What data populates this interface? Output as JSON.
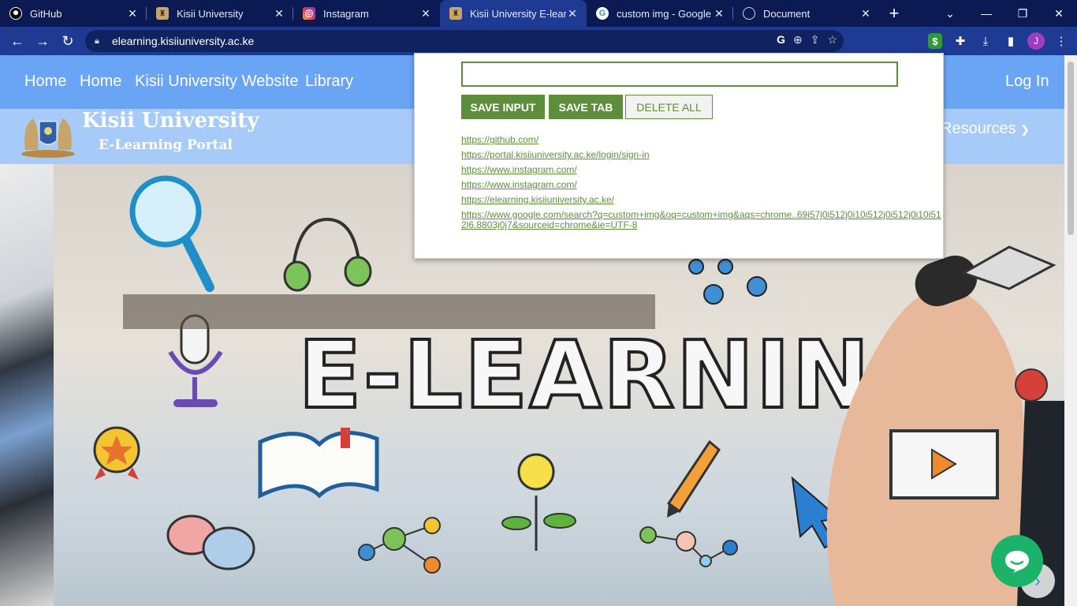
{
  "browser": {
    "tabs": [
      {
        "title": "GitHub",
        "icon": "github-icon"
      },
      {
        "title": "Kisii University",
        "icon": "kisii-crest-icon"
      },
      {
        "title": "Instagram",
        "icon": "instagram-icon"
      },
      {
        "title": "Kisii University E-learn",
        "icon": "kisii-crest-icon",
        "active": true
      },
      {
        "title": "custom img - Google",
        "icon": "google-icon"
      },
      {
        "title": "Document",
        "icon": "globe-icon"
      }
    ],
    "url": "elearning.kisiiuniversity.ac.ke",
    "profile_initial": "J"
  },
  "site": {
    "nav": [
      "Home",
      "Home",
      "Kisii University Website",
      "Library"
    ],
    "login": "Log In",
    "brand_title": "Kisii University",
    "brand_subtitle": "E-Learning Portal",
    "resources": "Resources"
  },
  "popup": {
    "input_value": "",
    "buttons": {
      "save_input": "SAVE INPUT",
      "save_tab": "SAVE TAB",
      "delete_all": "DELETE ALL"
    },
    "links": [
      "https://github.com/",
      "https://portal.kisiiuniversity.ac.ke/login/sign-in",
      "https://www.instagram.com/",
      "https://www.instagram.com/",
      "https://elearning.kisiiuniversity.ac.ke/",
      "https://www.google.com/search?q=custom+img&oq=custom+img&aqs=chrome..69i57j0i512j0i10i512j0i512j0i10i512l6.8803j0j7&sourceid=chrome&ie=UTF-8"
    ]
  },
  "hero": {
    "headline": "E-LEARNING"
  },
  "colors": {
    "accent": "#5d8f3a",
    "nav_bg": "#6aa4f5",
    "brand_bg": "#a7cbf9",
    "chrome": "#1f3a93"
  }
}
